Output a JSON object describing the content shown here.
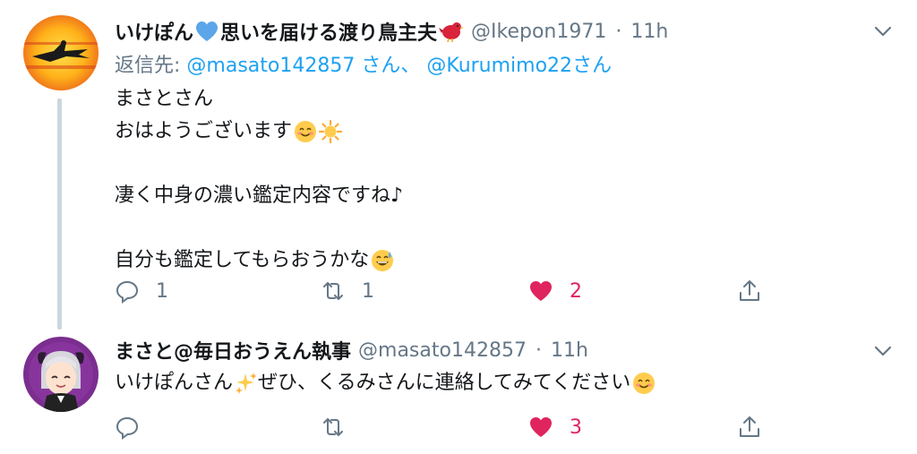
{
  "tweets": [
    {
      "author": {
        "name": "いけぽん",
        "name_suffix": "思いを届ける渡り鳥主夫",
        "handle": "@Ikepon1971"
      },
      "time": "11h",
      "separator": "·",
      "reply_to": {
        "prefix": "返信先:",
        "mention1": "@masato142857",
        "suffix1": " さん、",
        "mention2": "@Kurumimo22",
        "suffix2": "さん"
      },
      "body_lines": [
        "まさとさん",
        "おはようございます",
        "",
        "凄く中身の濃い鑑定内容ですね♪",
        "",
        "自分も鑑定してもらおうかな"
      ],
      "stats": {
        "replies": "1",
        "retweets": "1",
        "likes": "2"
      },
      "icons": [
        "blue-heart-icon",
        "red-bird-icon",
        "smile-emoji-icon",
        "sun-emoji-icon",
        "sweat-smile-emoji-icon"
      ]
    },
    {
      "author": {
        "name": "まさと@毎日おうえん執事",
        "handle": "@masato142857"
      },
      "time": "11h",
      "separator": "·",
      "body_lines": [
        "いけぽんさん",
        "ぜひ、くるみさんに連絡してみてください"
      ],
      "stats": {
        "replies": "",
        "retweets": "",
        "likes": "3"
      },
      "icons": [
        "sparkles-emoji-icon",
        "smile-emoji-icon"
      ]
    }
  ],
  "colors": {
    "link": "#1da1f2",
    "muted": "#657786",
    "like": "#e0245e",
    "thread": "#ccd6dd"
  }
}
